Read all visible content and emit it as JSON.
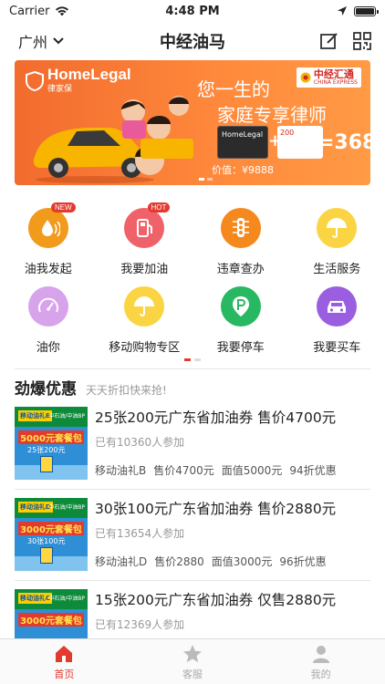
{
  "status": {
    "carrier": "Carrier",
    "time": "4:48 PM",
    "battery_level": 1.0
  },
  "nav": {
    "city": "广州",
    "title": "中经油马",
    "icons": [
      "edit-icon",
      "qrcode-icon"
    ]
  },
  "banner": {
    "logo_text": "HomeLegal",
    "logo_sub": "律家保",
    "partner_logo": "中经汇通",
    "partner_sub": "CHINA EXPRESS",
    "slogan_line1": "您一生的",
    "slogan_line2": "家庭专享律师",
    "card_label": "HomeLegal",
    "card2_value": "200",
    "equals_price": "=368",
    "original_price": "价值：¥9888"
  },
  "grid": [
    {
      "label": "油我发起",
      "icon": "oil-drop-icon",
      "color": "#f29a1b",
      "badge": "NEW"
    },
    {
      "label": "我要加油",
      "icon": "fuel-pump-icon",
      "color": "#f0626a",
      "badge": "HOT"
    },
    {
      "label": "违章查办",
      "icon": "traffic-light-icon",
      "color": "#f5891e",
      "badge": ""
    },
    {
      "label": "生活服务",
      "icon": "umbrella-icon",
      "color": "#fbd443",
      "badge": ""
    },
    {
      "label": "油你",
      "icon": "speedometer-icon",
      "color": "#d7a3ea",
      "badge": ""
    },
    {
      "label": "移动购物专区",
      "icon": "umbrella-icon",
      "color": "#fbd443",
      "badge": ""
    },
    {
      "label": "我要停车",
      "icon": "parking-icon",
      "color": "#29b862",
      "badge": ""
    },
    {
      "label": "我要买车",
      "icon": "car-icon",
      "color": "#9a5ee0",
      "badge": ""
    }
  ],
  "section": {
    "title": "劲爆优惠",
    "subtitle": "天天折扣快来抢!"
  },
  "deals": [
    {
      "title": "25张200元广东省加油券  售价4700元",
      "joined": "已有10360人参加",
      "meta": [
        "移动油礼B",
        "售价4700元",
        "面值5000元",
        "94折优惠"
      ],
      "img_tag": "移动油礼B",
      "img_brand": "中石油/中油BP",
      "img_big": "5000元套餐包",
      "img_small": "25张200元"
    },
    {
      "title": "30张100元广东省加油券  售价2880元",
      "joined": "已有13654人参加",
      "meta": [
        "移动油礼D",
        "售价2880",
        "面值3000元",
        "96折优惠"
      ],
      "img_tag": "移动油礼D",
      "img_brand": "中石油/中油BP",
      "img_big": "3000元套餐包",
      "img_small": "30张100元"
    },
    {
      "title": "15张200元广东省加油券  仅售2880元",
      "joined": "已有12369人参加",
      "meta": [],
      "img_tag": "移动油礼C",
      "img_brand": "中石油/中油BP",
      "img_big": "3000元套餐包",
      "img_small": ""
    }
  ],
  "tabs": [
    {
      "label": "首页",
      "icon": "home-icon",
      "active": true
    },
    {
      "label": "客服",
      "icon": "star-icon",
      "active": false
    },
    {
      "label": "我的",
      "icon": "user-icon",
      "active": false
    }
  ]
}
